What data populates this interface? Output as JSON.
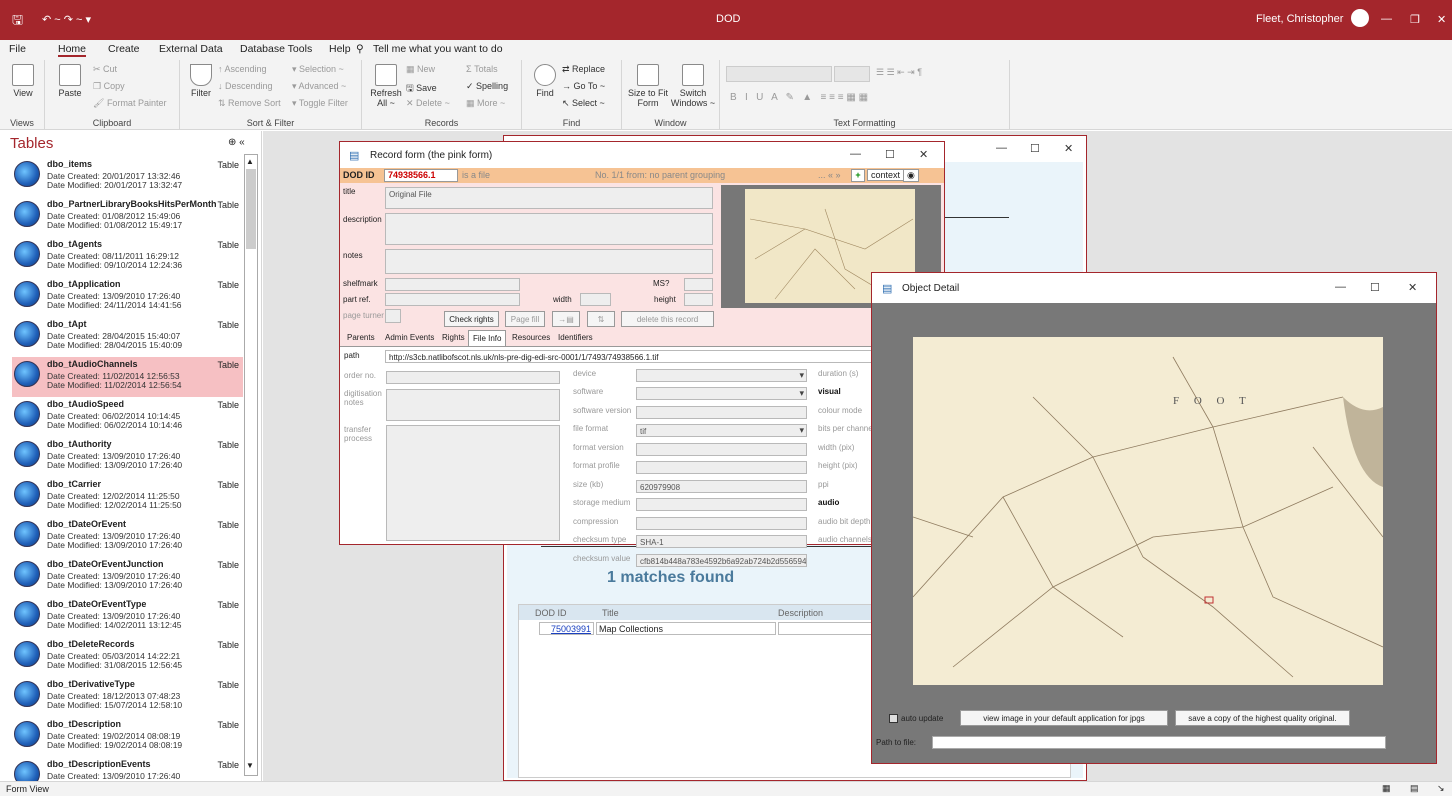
{
  "titlebar": {
    "title": "DOD",
    "user": "Fleet, Christopher"
  },
  "menu": [
    "File",
    "Home",
    "Create",
    "External Data",
    "Database Tools",
    "Help",
    "Tell me what you want to do"
  ],
  "ribbon": {
    "views": {
      "view": "View",
      "label": "Views"
    },
    "clipboard": {
      "paste": "Paste",
      "cut": "Cut",
      "copy": "Copy",
      "format_painter": "Format Painter",
      "label": "Clipboard"
    },
    "sort": {
      "filter": "Filter",
      "ascending": "Ascending",
      "descending": "Descending",
      "remove_sort": "Remove Sort",
      "selection": "Selection ~",
      "advanced": "Advanced ~",
      "toggle_filter": "Toggle Filter",
      "label": "Sort & Filter"
    },
    "records": {
      "refresh": "Refresh All ~",
      "new": "New",
      "save": "Save",
      "delete": "Delete ~",
      "totals": "Totals",
      "spelling": "Spelling",
      "more": "More ~",
      "label": "Records"
    },
    "find": {
      "find": "Find",
      "replace": "Replace",
      "goto": "Go To ~",
      "select": "Select ~",
      "label": "Find"
    },
    "window": {
      "size": "Size to Fit Form",
      "switch": "Switch Windows ~",
      "label": "Window"
    },
    "text": {
      "label": "Text Formatting"
    }
  },
  "nav": {
    "header": "Tables",
    "items": [
      {
        "name": "dbo_items",
        "type": "Table",
        "created": "Date Created: 20/01/2017 13:32:46",
        "modified": "Date Modified: 20/01/2017 13:32:47"
      },
      {
        "name": "dbo_PartnerLibraryBooksHitsPerMonth",
        "type": "Table",
        "created": "Date Created: 01/08/2012 15:49:06",
        "modified": "Date Modified: 01/08/2012 15:49:17"
      },
      {
        "name": "dbo_tAgents",
        "type": "Table",
        "created": "Date Created: 08/11/2011 16:29:12",
        "modified": "Date Modified: 09/10/2014 12:24:36"
      },
      {
        "name": "dbo_tApplication",
        "type": "Table",
        "created": "Date Created: 13/09/2010 17:26:40",
        "modified": "Date Modified: 24/11/2014 14:41:56"
      },
      {
        "name": "dbo_tApt",
        "type": "Table",
        "created": "Date Created: 28/04/2015 15:40:07",
        "modified": "Date Modified: 28/04/2015 15:40:09"
      },
      {
        "name": "dbo_tAudioChannels",
        "type": "Table",
        "created": "Date Created: 11/02/2014 12:56:53",
        "modified": "Date Modified: 11/02/2014 12:56:54"
      },
      {
        "name": "dbo_tAudioSpeed",
        "type": "Table",
        "created": "Date Created: 06/02/2014 10:14:45",
        "modified": "Date Modified: 06/02/2014 10:14:46"
      },
      {
        "name": "dbo_tAuthority",
        "type": "Table",
        "created": "Date Created: 13/09/2010 17:26:40",
        "modified": "Date Modified: 13/09/2010 17:26:40"
      },
      {
        "name": "dbo_tCarrier",
        "type": "Table",
        "created": "Date Created: 12/02/2014 11:25:50",
        "modified": "Date Modified: 12/02/2014 11:25:50"
      },
      {
        "name": "dbo_tDateOrEvent",
        "type": "Table",
        "created": "Date Created: 13/09/2010 17:26:40",
        "modified": "Date Modified: 13/09/2010 17:26:40"
      },
      {
        "name": "dbo_tDateOrEventJunction",
        "type": "Table",
        "created": "Date Created: 13/09/2010 17:26:40",
        "modified": "Date Modified: 13/09/2010 17:26:40"
      },
      {
        "name": "dbo_tDateOrEventType",
        "type": "Table",
        "created": "Date Created: 13/09/2010 17:26:40",
        "modified": "Date Modified: 14/02/2011 13:12:45"
      },
      {
        "name": "dbo_tDeleteRecords",
        "type": "Table",
        "created": "Date Created: 05/03/2014 14:22:21",
        "modified": "Date Modified: 31/08/2015 12:56:45"
      },
      {
        "name": "dbo_tDerivativeType",
        "type": "Table",
        "created": "Date Created: 18/12/2013 07:48:23",
        "modified": "Date Modified: 15/07/2014 12:58:10"
      },
      {
        "name": "dbo_tDescription",
        "type": "Table",
        "created": "Date Created: 19/02/2014 08:08:19",
        "modified": "Date Modified: 19/02/2014 08:08:19"
      },
      {
        "name": "dbo_tDescriptionEvents",
        "type": "Table",
        "created": "Date Created: 13/09/2010 17:26:40",
        "modified": ""
      }
    ]
  },
  "record": {
    "title": "Record form (the pink form)",
    "dod_label": "DOD ID",
    "dod_id": "74938566.1",
    "is_file": "is a file",
    "grouping": "No. 1/1 from: no parent grouping",
    "context": "context",
    "labels": {
      "title": "title",
      "description": "description",
      "notes": "notes",
      "shelfmark": "shelfmark",
      "partref": "part ref.",
      "pageturner": "page turner",
      "ms": "MS?",
      "width": "width",
      "height": "height"
    },
    "title_value": "Original File",
    "buttons": {
      "check_rights": "Check rights",
      "page_fill": "Page fill",
      "delete": "delete this record"
    },
    "tabs": [
      "Parents",
      "Admin Events",
      "Rights",
      "File Info",
      "Resources",
      "Identifiers"
    ],
    "path_label": "path",
    "path": "http://s3cb.natlibofscot.nls.uk/nls-pre-dig-edi-src-0001/1/7493/74938566.1.tif",
    "left_labels": [
      "order no.",
      "digitisation notes",
      "transfer process"
    ],
    "mid": [
      {
        "label": "device",
        "value": ""
      },
      {
        "label": "software",
        "value": ""
      },
      {
        "label": "software version",
        "value": ""
      },
      {
        "label": "file format",
        "value": "tif"
      },
      {
        "label": "format version",
        "value": ""
      },
      {
        "label": "format profile",
        "value": ""
      },
      {
        "label": "size (kb)",
        "value": "620979908"
      },
      {
        "label": "storage medium",
        "value": ""
      },
      {
        "label": "compression",
        "value": ""
      },
      {
        "label": "checksum type",
        "value": "SHA-1"
      },
      {
        "label": "checksum value",
        "value": "cfb814b448a783e4592b6a92ab724b2d556594"
      }
    ],
    "right": [
      "duration (s)",
      "visual",
      "colour mode",
      "bits per channe",
      "width (pix)",
      "height (pix)",
      "ppi",
      "audio",
      "audio bit depth",
      "audio channels"
    ]
  },
  "search": {
    "matches": "1 matches found",
    "cols": [
      "DOD ID",
      "Title",
      "Description"
    ],
    "row": {
      "id": "75003991",
      "title": "Map Collections"
    }
  },
  "object": {
    "title": "Object Detail",
    "auto_update": "auto update",
    "view_btn": "view image in your default application for jpgs",
    "save_btn": "save a copy of the highest quality original.",
    "path_label": "Path to file:",
    "map_text": "F  O  O  T"
  },
  "status": {
    "text": "Form View"
  }
}
